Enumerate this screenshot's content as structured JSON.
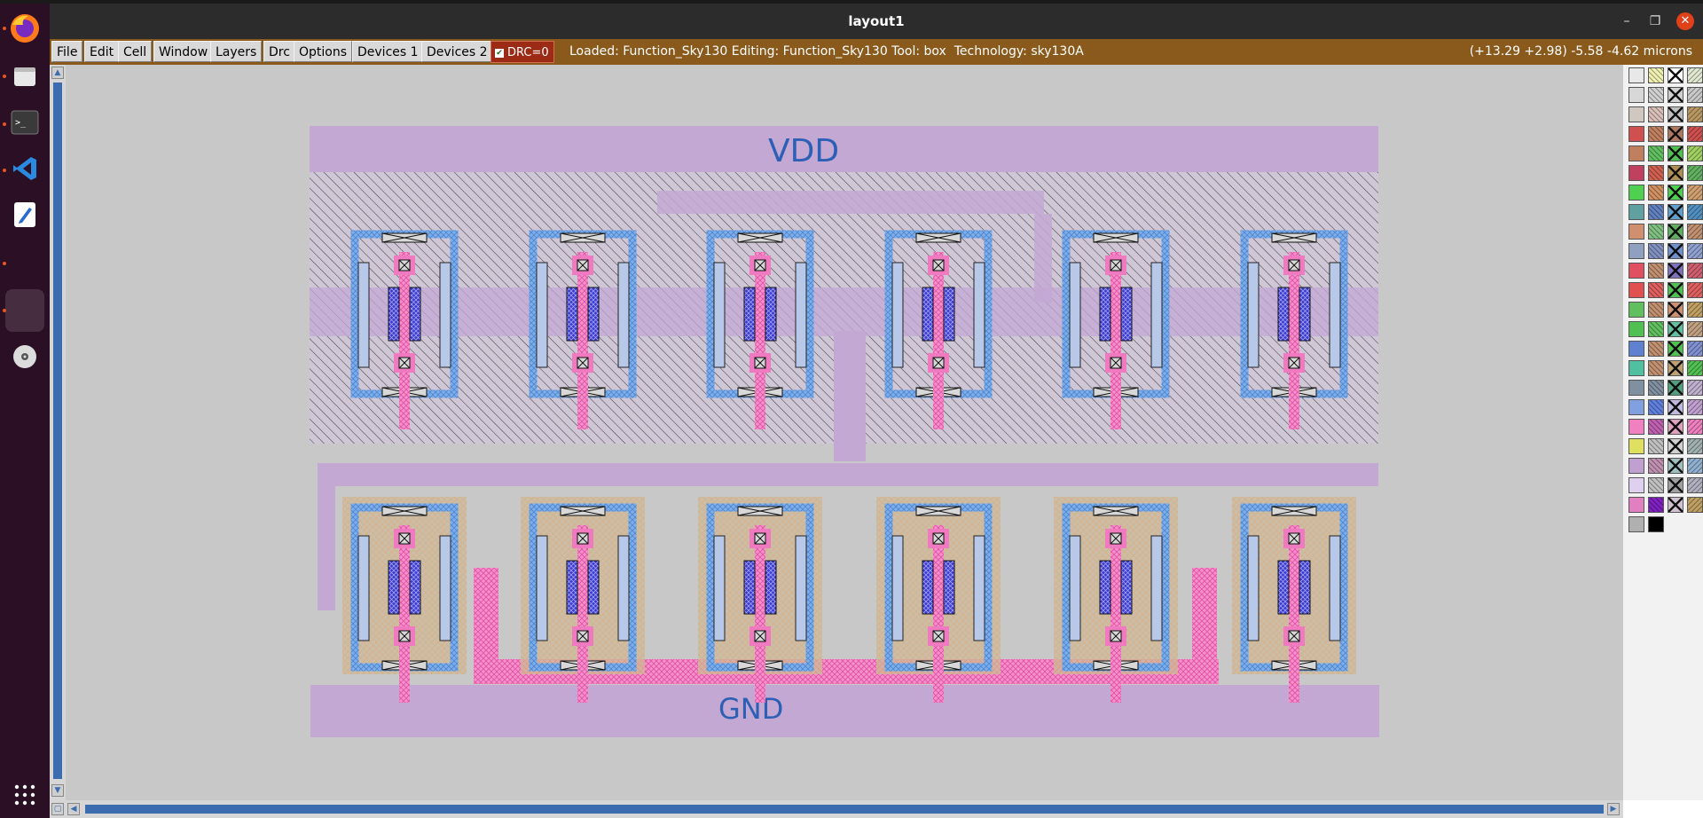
{
  "window": {
    "title": "layout1"
  },
  "menu": {
    "file": "File",
    "edit": "Edit",
    "cell": "Cell",
    "window": "Window",
    "layers": "Layers",
    "drc": "Drc",
    "options": "Options",
    "devices1": "Devices 1",
    "devices2": "Devices 2"
  },
  "drc_status": {
    "label": "DRC=0",
    "checked": true
  },
  "status_line": "Loaded: Function_Sky130 Editing: Function_Sky130 Tool: box  Technology: sky130A",
  "coordinates": "(+13.29 +2.98) -5.58 -4.62 microns",
  "layout": {
    "vdd_label": "VDD",
    "gnd_label": "GND",
    "pmos_count": 6,
    "nmos_count": 6
  },
  "dock": [
    "firefox-icon",
    "files-icon",
    "terminal-icon",
    "vscode-icon",
    "text-editor-icon",
    "blank-app-icon",
    "dvd-icon",
    "app-grid-icon"
  ],
  "colors": {
    "dock_bg": "#2b0f24",
    "titlebar_bg": "#2c2c2c",
    "menubar_bg": "#8a5a1c",
    "canvas_bg": "#c8c8c8",
    "metal1": "#c3a8d4",
    "poly": "#f07ac0",
    "nwell": "#7aa6e0",
    "diff": "#3333c0",
    "label_blue": "#2d5fb5"
  }
}
